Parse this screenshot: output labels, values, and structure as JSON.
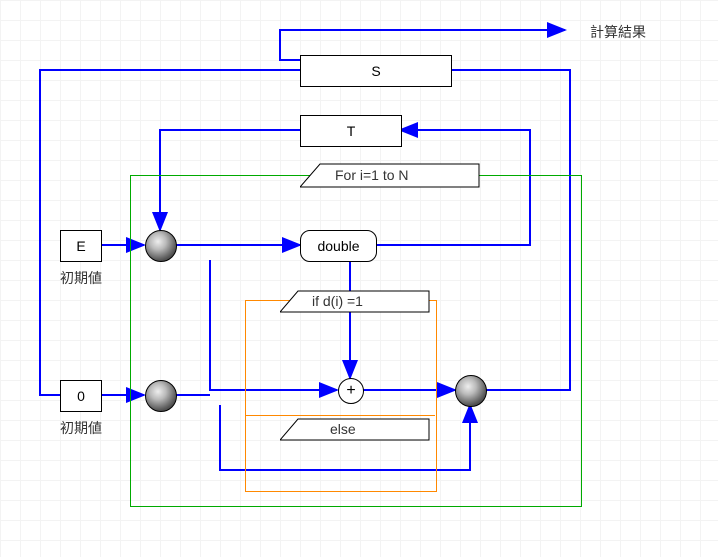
{
  "labels": {
    "result": "計算結果",
    "initial_E": "初期値",
    "initial_0": "初期値"
  },
  "blocks": {
    "S": "S",
    "T": "T",
    "E": "E",
    "zero": "0",
    "dbl": "double",
    "plus": "+"
  },
  "frames": {
    "for": "For i=1 to N",
    "if": "if d(i) =1",
    "else": "else"
  },
  "chart_data": {
    "type": "diagram",
    "description": "Block/flow diagram for iterative doubling with conditional add (binary method for scalar multiplication)",
    "nodes": [
      {
        "id": "S",
        "kind": "register",
        "label": "S"
      },
      {
        "id": "T",
        "kind": "register",
        "label": "T"
      },
      {
        "id": "E",
        "kind": "const",
        "label": "E",
        "note": "初期値"
      },
      {
        "id": "zero",
        "kind": "const",
        "label": "0",
        "note": "初期値"
      },
      {
        "id": "double",
        "kind": "op",
        "label": "double"
      },
      {
        "id": "add",
        "kind": "op",
        "label": "+"
      },
      {
        "id": "mergeTop",
        "kind": "merge"
      },
      {
        "id": "mergeBottom",
        "kind": "merge"
      },
      {
        "id": "mergeIf",
        "kind": "merge"
      }
    ],
    "frames": [
      {
        "id": "forLoop",
        "label": "For i=1 to N",
        "contains": [
          "double",
          "add",
          "mergeTop",
          "mergeBottom",
          "mergeIf",
          "ifFrame"
        ]
      },
      {
        "id": "ifFrame",
        "label": "if d(i) =1",
        "else": "else",
        "contains": [
          "add"
        ]
      }
    ],
    "edges": [
      {
        "from": "E",
        "to": "mergeTop"
      },
      {
        "from": "T",
        "to": "mergeTop"
      },
      {
        "from": "mergeTop",
        "to": "double"
      },
      {
        "from": "double",
        "to": "T",
        "note": "loop back"
      },
      {
        "from": "double",
        "to": "add",
        "branch": "if d(i)=1"
      },
      {
        "from": "mergeTop",
        "to": "add",
        "note": "pass-through to adder other input"
      },
      {
        "from": "zero",
        "to": "mergeBottom"
      },
      {
        "from": "S",
        "to": "mergeBottom"
      },
      {
        "from": "mergeBottom",
        "to": "add"
      },
      {
        "from": "mergeBottom",
        "to": "mergeIf",
        "branch": "else (pass-through)"
      },
      {
        "from": "add",
        "to": "mergeIf"
      },
      {
        "from": "mergeIf",
        "to": "S",
        "note": "loop back"
      },
      {
        "from": "S",
        "to": "result",
        "label": "計算結果"
      }
    ]
  }
}
